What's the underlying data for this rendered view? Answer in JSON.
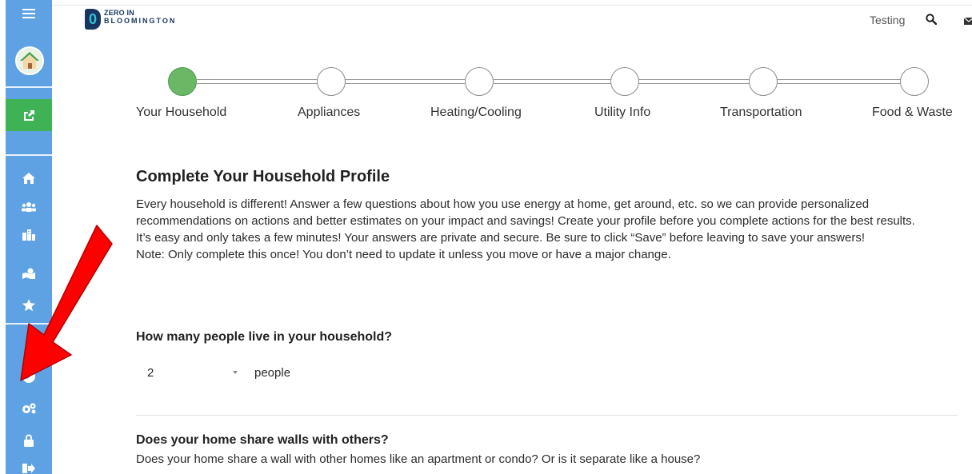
{
  "header": {
    "logo_top": "ZERO IN",
    "logo_bottom": "BLOOMINGTON",
    "logo_mark": "0",
    "user_label": "Testing",
    "search_icon": "search-icon",
    "mail_icon": "envelope-icon"
  },
  "sidebar": {
    "items": [
      {
        "icon": "hamburger-menu-icon"
      },
      {
        "icon": "avatar-house"
      },
      {
        "icon": "share-icon"
      },
      {
        "icon": "home-icon"
      },
      {
        "icon": "users-icon"
      },
      {
        "icon": "buildings-icon"
      },
      {
        "icon": "map-icon"
      },
      {
        "icon": "star-icon"
      },
      {
        "icon": "compass-icon"
      },
      {
        "icon": "cogs-icon"
      },
      {
        "icon": "lock-icon"
      },
      {
        "icon": "logout-icon"
      }
    ],
    "accent_color": "#5ea2e3",
    "active_color": "#3fb255"
  },
  "stepper": {
    "steps": [
      {
        "label": "Your Household",
        "active": true
      },
      {
        "label": "Appliances",
        "active": false
      },
      {
        "label": "Heating/Cooling",
        "active": false
      },
      {
        "label": "Utility Info",
        "active": false
      },
      {
        "label": "Transportation",
        "active": false
      },
      {
        "label": "Food & Waste",
        "active": false
      }
    ],
    "active_color": "#6ab766"
  },
  "main": {
    "title": "Complete Your Household Profile",
    "paragraph_1": "Every household is different! Answer a few questions about how you use energy at home, get around, etc. so we can provide personalized recommendations on actions and better estimates on your impact and savings! Create your profile before you complete actions for the best results.",
    "paragraph_2": "It’s easy and only takes a few minutes! Your answers are private and secure. Be sure to click “Save” before leaving to save your answers!",
    "paragraph_3": "Note: Only complete this once! You don’t need to update it unless you move or have a major change.",
    "question_1": {
      "title": "How many people live in your household?",
      "selected_value": "2",
      "unit": "people"
    },
    "question_2": {
      "title": "Does your home share walls with others?",
      "description": "Does your home share a wall with other homes like an apartment or condo?  Or is it separate like a house?"
    }
  },
  "annotation": {
    "arrow_color": "#ff0000"
  }
}
